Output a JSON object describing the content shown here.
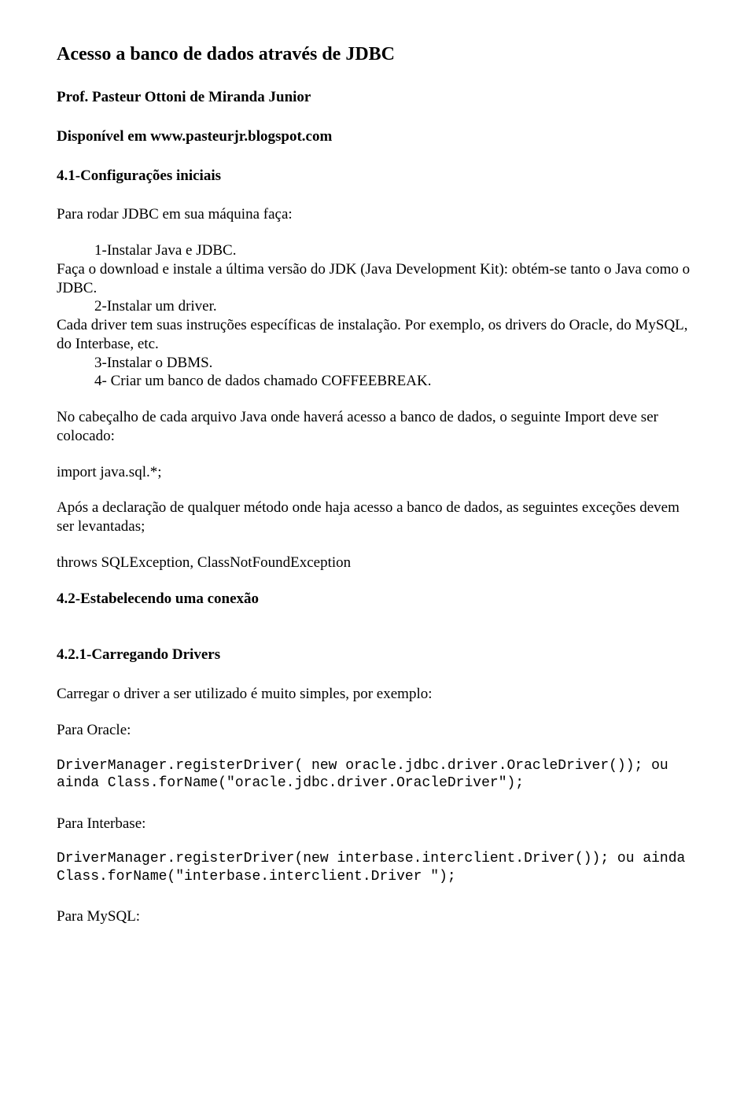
{
  "title": "Acesso a banco de dados através de JDBC",
  "author_line": "Prof. Pasteur Ottoni de Miranda Junior",
  "avail_line": "Disponível em www.pasteurjr.blogspot.com",
  "sec41": {
    "heading": "4.1-Configurações iniciais",
    "intro": "Para rodar JDBC em sua máquina faça:",
    "step1": "1-Instalar Java e JDBC. Faça o download e instale a última versão do JDK (Java Development Kit): obtém-se tanto o Java como o JDBC.",
    "step1_indent": "1-Instalar Java e JDBC.",
    "step1_rest": "Faça o download e instale a última versão do JDK (Java Development Kit): obtém-se tanto o Java como o JDBC.",
    "step2": "2-Instalar um driver. Cada driver tem suas instruções específicas de instalação. Por exemplo, os drivers do Oracle, do MySQL, do Interbase, etc.",
    "step2_indent": "2-Instalar um driver.",
    "step2_rest": "Cada driver tem suas instruções específicas de instalação. Por exemplo, os drivers do Oracle, do MySQL, do Interbase, etc.",
    "step3": "3-Instalar o DBMS.",
    "step4": "4- Criar um banco de dados chamado COFFEEBREAK.",
    "para_header": "No cabeçalho de cada arquivo Java onde haverá acesso a banco de dados, o seguinte Import deve ser colocado:",
    "import_line": "import java.sql.*;",
    "para_after_decl": "Após a declaração de qualquer método onde haja acesso a banco de dados, as seguintes exceções devem ser levantadas;",
    "throws_line": "throws SQLException, ClassNotFoundException"
  },
  "sec42": {
    "heading": "4.2-Estabelecendo uma conexão"
  },
  "sec421": {
    "heading": "4.2.1-Carregando Drivers",
    "intro": "Carregar o driver a ser utilizado é muito simples, por exemplo:",
    "oracle_label": "Para Oracle:",
    "oracle_code": "DriverManager.registerDriver( new oracle.jdbc.driver.OracleDriver()); ou ainda Class.forName(\"oracle.jdbc.driver.OracleDriver\");",
    "interbase_label": "Para Interbase:",
    "interbase_code": "DriverManager.registerDriver(new interbase.interclient.Driver()); ou ainda Class.forName(\"interbase.interclient.Driver \");",
    "mysql_label": "Para MySQL:"
  }
}
